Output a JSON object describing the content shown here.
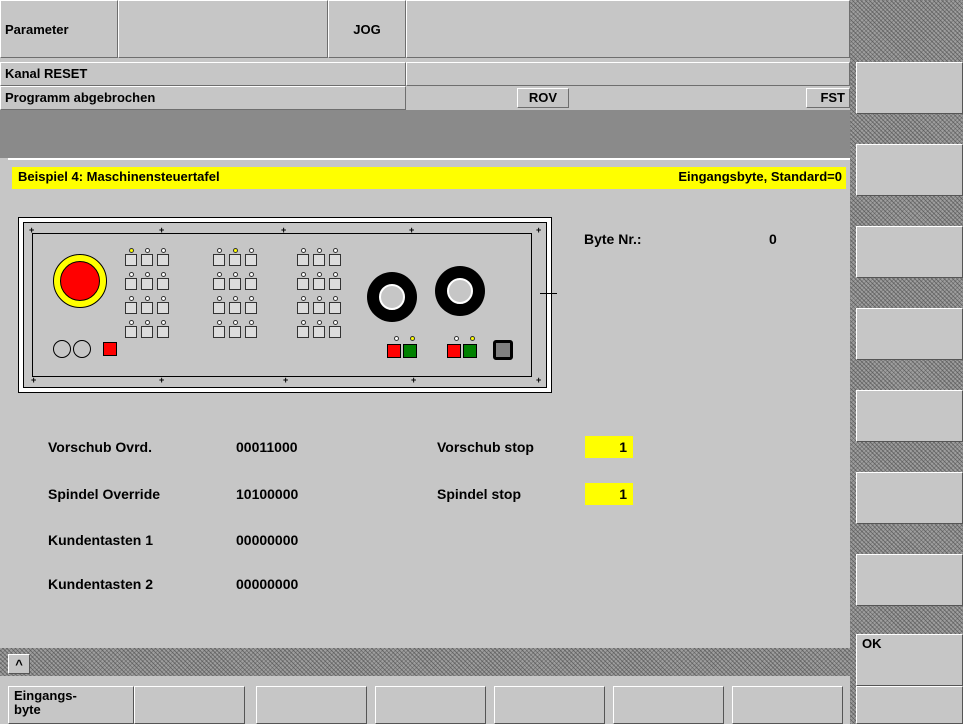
{
  "header": {
    "area": "Parameter",
    "mode": "JOG",
    "channel_state": "Kanal RESET",
    "program_state": "Programm abgebrochen",
    "rov": "ROV",
    "fst": "FST"
  },
  "title_bar": {
    "left": "Beispiel 4: Maschinensteuertafel",
    "right": "Eingangsbyte, Standard=0"
  },
  "panel": {
    "byte_label": "Byte Nr.:",
    "byte_value": "0"
  },
  "fields": [
    {
      "label": "Vorschub Ovrd.",
      "value": "00011000"
    },
    {
      "label": "Spindel Override",
      "value": "10100000"
    },
    {
      "label": "Kundentasten 1",
      "value": "00000000"
    },
    {
      "label": "Kundentasten 2",
      "value": "00000000"
    }
  ],
  "stops": [
    {
      "label": "Vorschub stop",
      "value": "1"
    },
    {
      "label": "Spindel stop",
      "value": "1"
    }
  ],
  "recall_symbol": "^",
  "vertical_softkeys": [
    "",
    "",
    "",
    "",
    "",
    "",
    "",
    "OK"
  ],
  "horizontal_softkeys": [
    "Eingangs-\nbyte",
    "",
    "",
    "",
    "",
    "",
    "",
    ""
  ],
  "colors": {
    "title_bar_bg": "#ffff00",
    "estop_red": "#ff0000",
    "key_green": "#008000",
    "background": "#c6c6c6"
  }
}
